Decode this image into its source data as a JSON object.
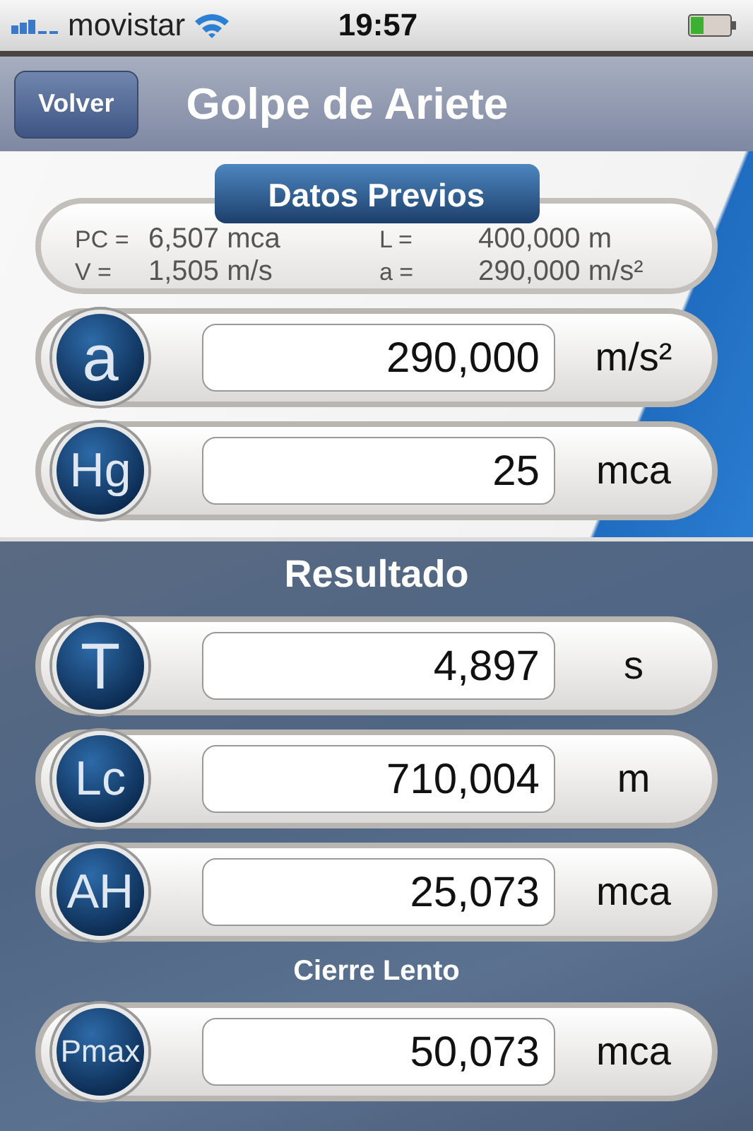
{
  "status_bar": {
    "carrier": "movistar",
    "time": "19:57"
  },
  "nav_bar": {
    "back_button": "Volver",
    "title": "Golpe de Ariete"
  },
  "inputs": {
    "heading": "Datos Previos",
    "summary": [
      {
        "label": "PC =",
        "value": "6,507 mca"
      },
      {
        "label": "L =",
        "value": "400,000 m"
      },
      {
        "label": "V =",
        "value": "1,505 m/s"
      },
      {
        "label": "a =",
        "value": "290,000 m/s²"
      }
    ],
    "rows": [
      {
        "symbol": "a",
        "value": "290,000",
        "unit": "m/s²"
      },
      {
        "symbol": "Hg",
        "value": "25",
        "unit": "mca"
      }
    ]
  },
  "results": {
    "heading": "Resultado",
    "rows": [
      {
        "symbol": "T",
        "value": "4,897",
        "unit": "s"
      },
      {
        "symbol": "Lc",
        "value": "710,004",
        "unit": "m"
      },
      {
        "symbol": "AH",
        "value": "25,073",
        "unit": "mca"
      }
    ],
    "subheading": "Cierre Lento",
    "slow_closure_rows": [
      {
        "symbol": "Pmax",
        "value": "50,073",
        "unit": "mca"
      }
    ]
  }
}
